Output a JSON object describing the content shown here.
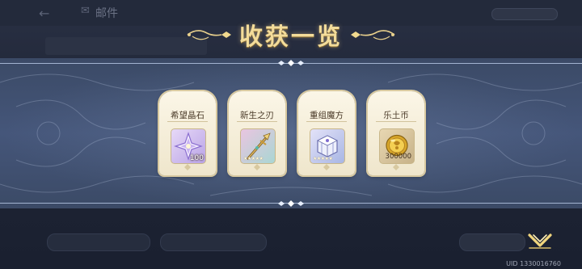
{
  "background": {
    "header_title": "邮件",
    "tab_left": "",
    "tab_right": "",
    "action_right": ""
  },
  "modal": {
    "title": "收获一览",
    "items": [
      {
        "name": "希望晶石",
        "count": "100",
        "icon": "crystal-star-icon"
      },
      {
        "name": "新生之刃",
        "count": "",
        "stars": "★★★★★",
        "icon": "golden-spear-icon"
      },
      {
        "name": "重组魔方",
        "count": "",
        "stars": "★★★★★",
        "icon": "magic-cube-icon"
      },
      {
        "name": "乐土币",
        "count": "300000",
        "icon": "gold-coin-icon"
      }
    ]
  },
  "footer": {
    "uid": "UID 1330016760"
  },
  "colors": {
    "title_gold": "#f3dc9a",
    "banner": "#45567a",
    "card": "#fbf6e7"
  }
}
